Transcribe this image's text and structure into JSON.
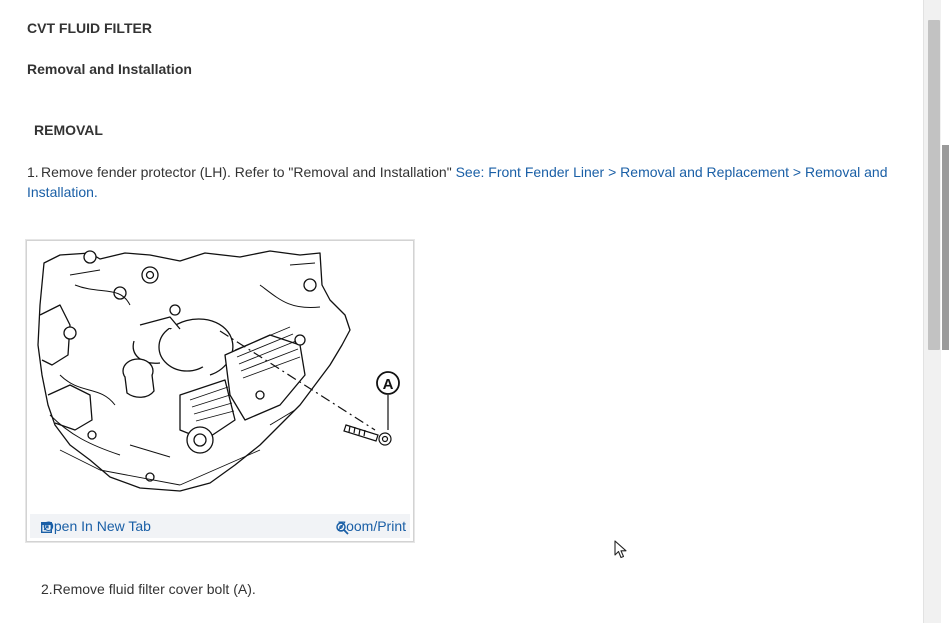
{
  "document": {
    "title": "CVT FLUID FILTER",
    "subtitle": "Removal and Installation",
    "section_heading": "REMOVAL",
    "step1": {
      "number": "1.",
      "text": "Remove fender protector (LH). Refer to \"Removal and Installation\" ",
      "link": "See: Front Fender Liner > Removal and Replacement > Removal and Installation."
    },
    "figure": {
      "callout_label": "A",
      "open_new_tab_label": "Open In New Tab",
      "zoom_print_label": "Zoom/Print"
    },
    "step2": {
      "number": "2.",
      "text": "Remove fluid filter cover bolt (A)."
    }
  },
  "icons": {
    "open_tab": "open-in-new-tab-icon",
    "zoom": "zoom-magnifier-icon",
    "cursor": "mouse-pointer-icon"
  },
  "colors": {
    "link": "#1a5fa6",
    "text": "#333333",
    "figure_bar": "#f1f3f6"
  }
}
